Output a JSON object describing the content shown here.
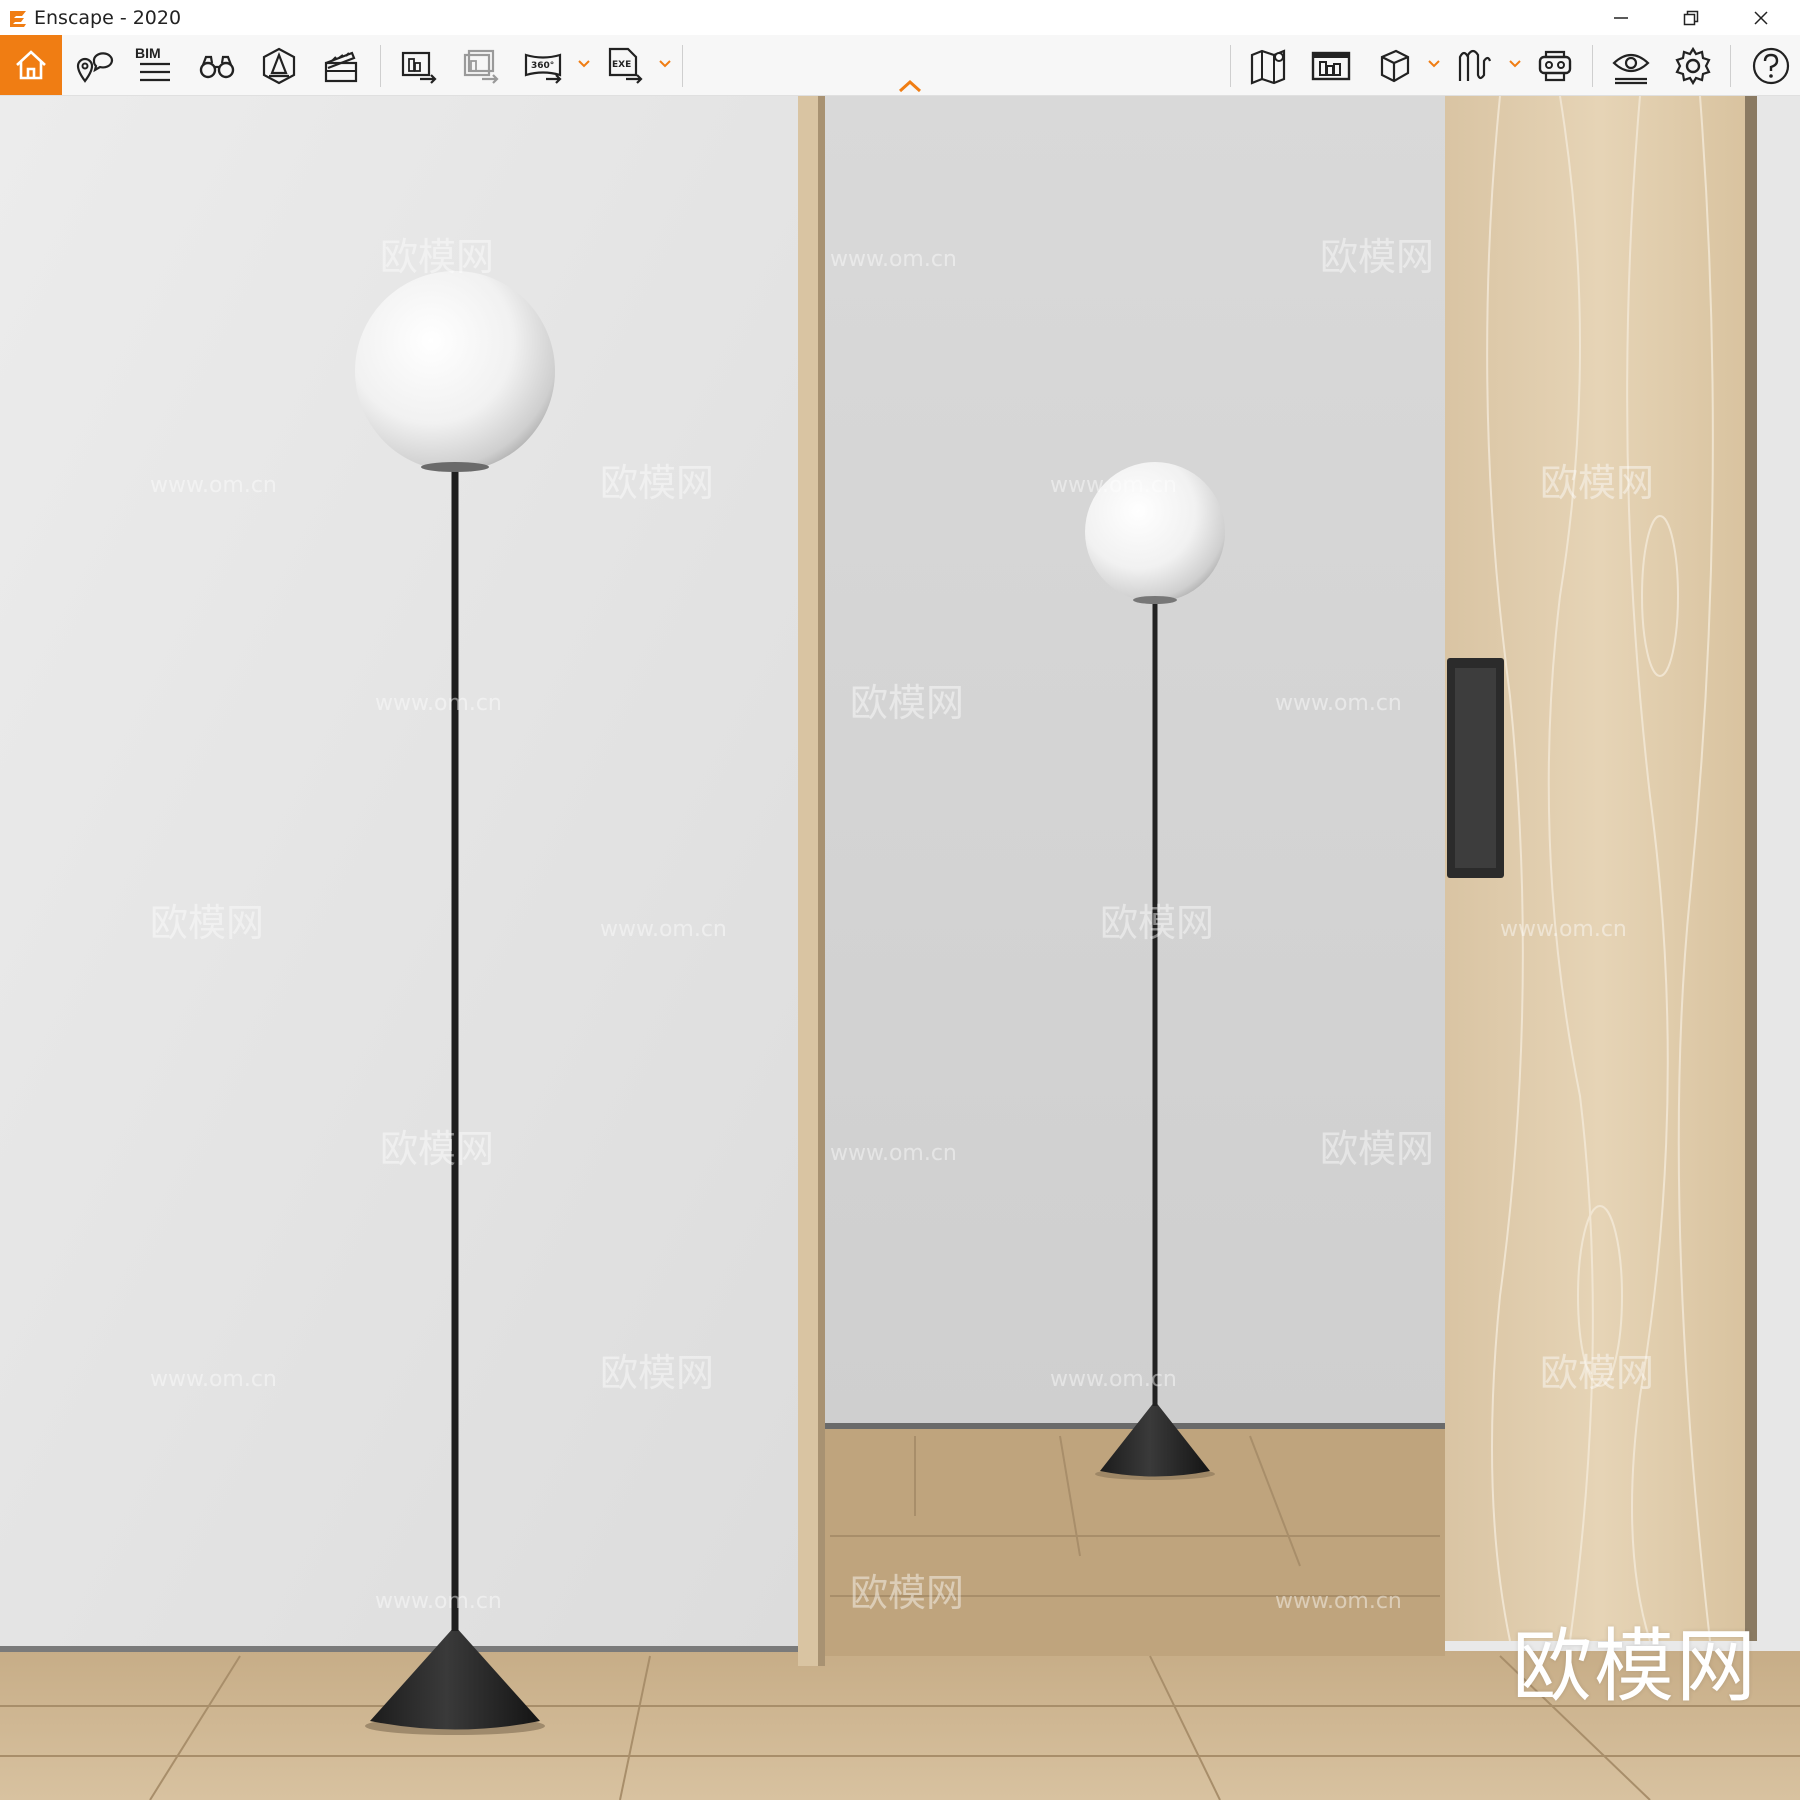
{
  "window": {
    "title": "Enscape - 2020",
    "controls": [
      "minimize",
      "restore",
      "close"
    ]
  },
  "toolbar": {
    "bim_label": "BIM",
    "panorama_label": "360°",
    "exe_label": "EXE",
    "accent_color": "#f07d13",
    "left_icons": [
      "home-icon",
      "location-chat-icon",
      "bim-list-icon",
      "binoculars-icon",
      "alert-cone-icon",
      "clapperboard-icon",
      "export-image-icon",
      "export-batch-icon",
      "panorama-360-icon",
      "exe-export-icon"
    ],
    "right_icons": [
      "map-icon",
      "building-icon",
      "cube-icon",
      "shadows-icon",
      "vr-headset-icon",
      "eye-icon",
      "gear-icon",
      "help-icon"
    ]
  },
  "viewport": {
    "watermark_text": "欧模网",
    "watermark_url": "www.om.cn",
    "brand_text": "欧模网"
  }
}
